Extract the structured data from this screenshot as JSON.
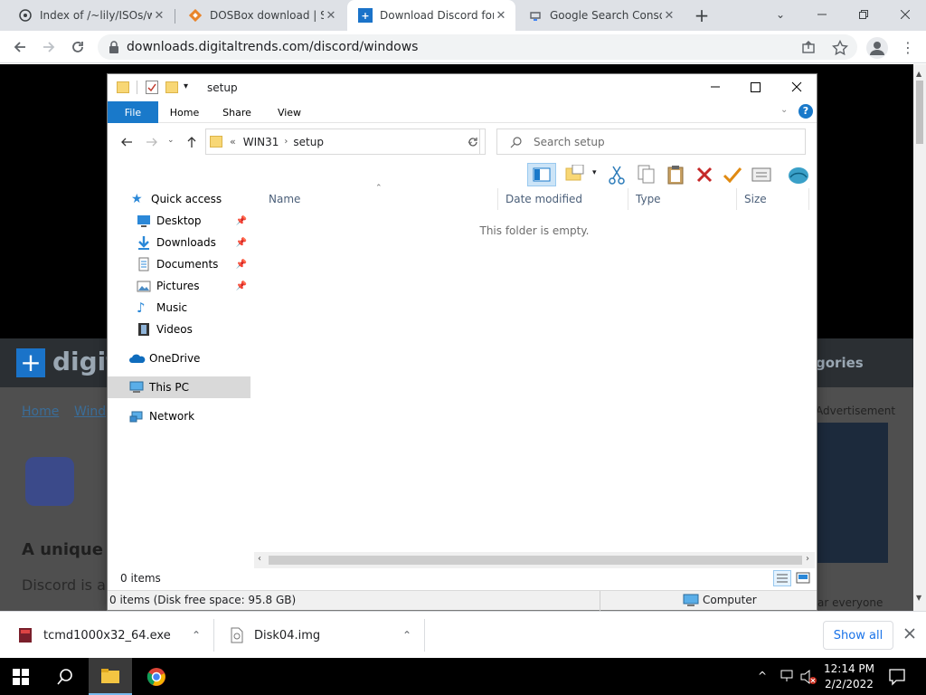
{
  "browser": {
    "tabs": [
      {
        "title": "Index of /~lily/ISOs/wi",
        "favicon": "github-like-icon"
      },
      {
        "title": "DOSBox download | So",
        "favicon": "dosbox-icon"
      },
      {
        "title": "Download Discord for",
        "favicon": "digitaltrends-icon",
        "active": true
      },
      {
        "title": "Google Search Console",
        "favicon": "search-console-icon"
      }
    ],
    "new_tab_glyph": "+",
    "url": "downloads.digitaltrends.com/discord/windows"
  },
  "explorer": {
    "title": "setup",
    "ribbon_tabs": [
      "File",
      "Home",
      "Share",
      "View"
    ],
    "address": {
      "chevron": "«",
      "segments": [
        "WIN31",
        "setup"
      ]
    },
    "search_placeholder": "Search setup",
    "nav": {
      "quick_access": "Quick access",
      "quick_items": [
        "Desktop",
        "Downloads",
        "Documents",
        "Pictures",
        "Music",
        "Videos"
      ],
      "onedrive": "OneDrive",
      "this_pc": "This PC",
      "network": "Network"
    },
    "columns": [
      "Name",
      "Date modified",
      "Type",
      "Size"
    ],
    "empty_message": "This folder is empty.",
    "item_count": "0 items",
    "status_text": "0 items (Disk free space: 95.8 GB)",
    "status_location": "Computer"
  },
  "page_bg": {
    "bg_texts": [
      "digit",
      "Home",
      "Wind",
      "A unique c",
      "Discord is a",
      "gories",
      "Advertisement",
      "ar everyone"
    ]
  },
  "downloads": {
    "items": [
      "tcmd1000x32_64.exe",
      "Disk04.img"
    ],
    "show_all": "Show all"
  },
  "taskbar": {
    "time": "12:14 PM",
    "date": "2/2/2022"
  },
  "colors": {
    "accent": "#1979ca",
    "taskbar": "#000000",
    "tab_strip": "#dee1e6"
  }
}
